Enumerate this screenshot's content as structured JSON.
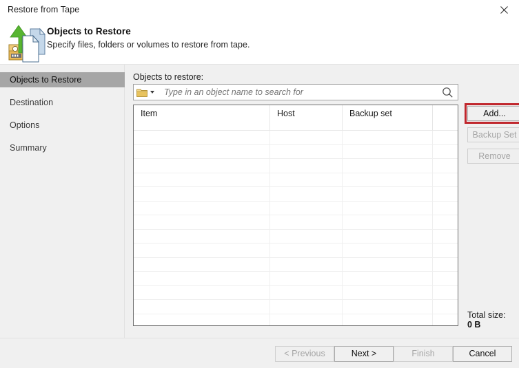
{
  "window": {
    "title": "Restore from Tape",
    "close_label": "×",
    "close_icon": "close-icon"
  },
  "banner": {
    "title": "Objects to Restore",
    "subtitle": "Specify files, folders or volumes to restore from tape.",
    "icon": "restore-from-tape-icon"
  },
  "sidebar": {
    "items": [
      {
        "label": "Objects to Restore",
        "selected": true
      },
      {
        "label": "Destination",
        "selected": false
      },
      {
        "label": "Options",
        "selected": false
      },
      {
        "label": "Summary",
        "selected": false
      }
    ]
  },
  "main": {
    "label": "Objects to restore:",
    "search": {
      "placeholder": "Type in an object name to search for",
      "value": "",
      "scope_icon": "folder-icon",
      "scope_caret_icon": "chevron-down-icon",
      "search_icon": "search-icon"
    },
    "table": {
      "columns": [
        "Item",
        "Host",
        "Backup set",
        ""
      ],
      "rows": [],
      "empty_row_count": 14
    },
    "buttons": [
      {
        "label": "Add...",
        "enabled": true,
        "highlighted": true
      },
      {
        "label": "Backup Set",
        "enabled": false,
        "highlighted": false
      },
      {
        "label": "Remove",
        "enabled": false,
        "highlighted": false
      }
    ],
    "totals": {
      "label": "Total size:",
      "value": "0 B"
    },
    "highlight_color": "#c0272d"
  },
  "footer": {
    "buttons": [
      {
        "label": "< Previous",
        "enabled": false
      },
      {
        "label": "Next >",
        "enabled": true
      },
      {
        "label": "Finish",
        "enabled": false
      },
      {
        "label": "Cancel",
        "enabled": true
      }
    ]
  }
}
